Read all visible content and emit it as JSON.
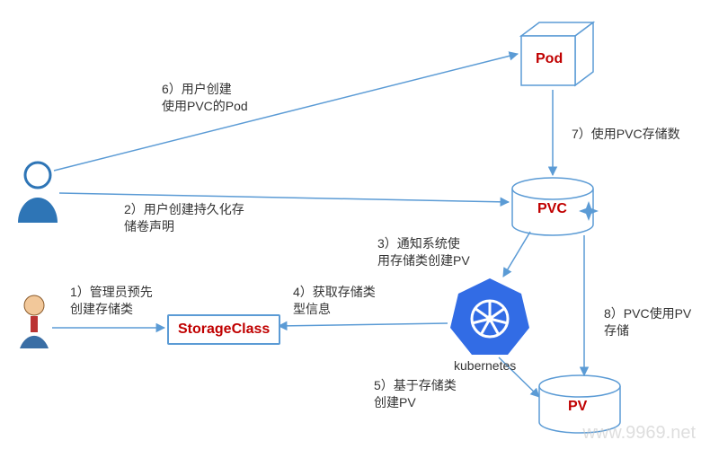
{
  "nodes": {
    "pod": "Pod",
    "pvc": "PVC",
    "pv": "PV",
    "storage_class": "StorageClass",
    "k8s": "kubernetes"
  },
  "actors": {
    "user": "user",
    "admin": "admin"
  },
  "steps": {
    "s1_l1": "1）管理员预先",
    "s1_l2": "创建存储类",
    "s2_l1": "2）用户创建持久化存",
    "s2_l2": "储卷声明",
    "s3_l1": "3）通知系统使",
    "s3_l2": "用存储类创建PV",
    "s4_l1": "4）获取存储类",
    "s4_l2": "型信息",
    "s5_l1": "5）基于存储类",
    "s5_l2": "创建PV",
    "s6_l1": "6）用户创建",
    "s6_l2": "使用PVC的Pod",
    "s7": "7）使用PVC存储数",
    "s8": "8）PVC使用PV存储"
  },
  "watermark": "www.9969.net",
  "colors": {
    "line": "#5b9bd5",
    "accent_red": "#c00000",
    "k8s_blue": "#326ce5"
  },
  "chart_data": {
    "type": "flow-diagram",
    "nodes": [
      {
        "id": "admin",
        "kind": "actor",
        "label": "管理员"
      },
      {
        "id": "user",
        "kind": "actor",
        "label": "用户"
      },
      {
        "id": "storageclass",
        "kind": "box",
        "label": "StorageClass"
      },
      {
        "id": "kubernetes",
        "kind": "system",
        "label": "kubernetes"
      },
      {
        "id": "pod",
        "kind": "cube",
        "label": "Pod"
      },
      {
        "id": "pvc",
        "kind": "cylinder",
        "label": "PVC"
      },
      {
        "id": "pv",
        "kind": "cylinder",
        "label": "PV"
      }
    ],
    "edges": [
      {
        "step": 1,
        "from": "admin",
        "to": "storageclass",
        "label": "管理员预先创建存储类"
      },
      {
        "step": 2,
        "from": "user",
        "to": "pvc",
        "label": "用户创建持久化存储卷声明"
      },
      {
        "step": 3,
        "from": "pvc",
        "to": "kubernetes",
        "label": "通知系统使用存储类创建PV"
      },
      {
        "step": 4,
        "from": "kubernetes",
        "to": "storageclass",
        "label": "获取存储类型信息"
      },
      {
        "step": 5,
        "from": "kubernetes",
        "to": "pv",
        "label": "基于存储类创建PV"
      },
      {
        "step": 6,
        "from": "user",
        "to": "pod",
        "label": "用户创建使用PVC的Pod"
      },
      {
        "step": 7,
        "from": "pod",
        "to": "pvc",
        "label": "使用PVC存储数据"
      },
      {
        "step": 8,
        "from": "pvc",
        "to": "pv",
        "label": "PVC使用PV存储"
      }
    ]
  }
}
